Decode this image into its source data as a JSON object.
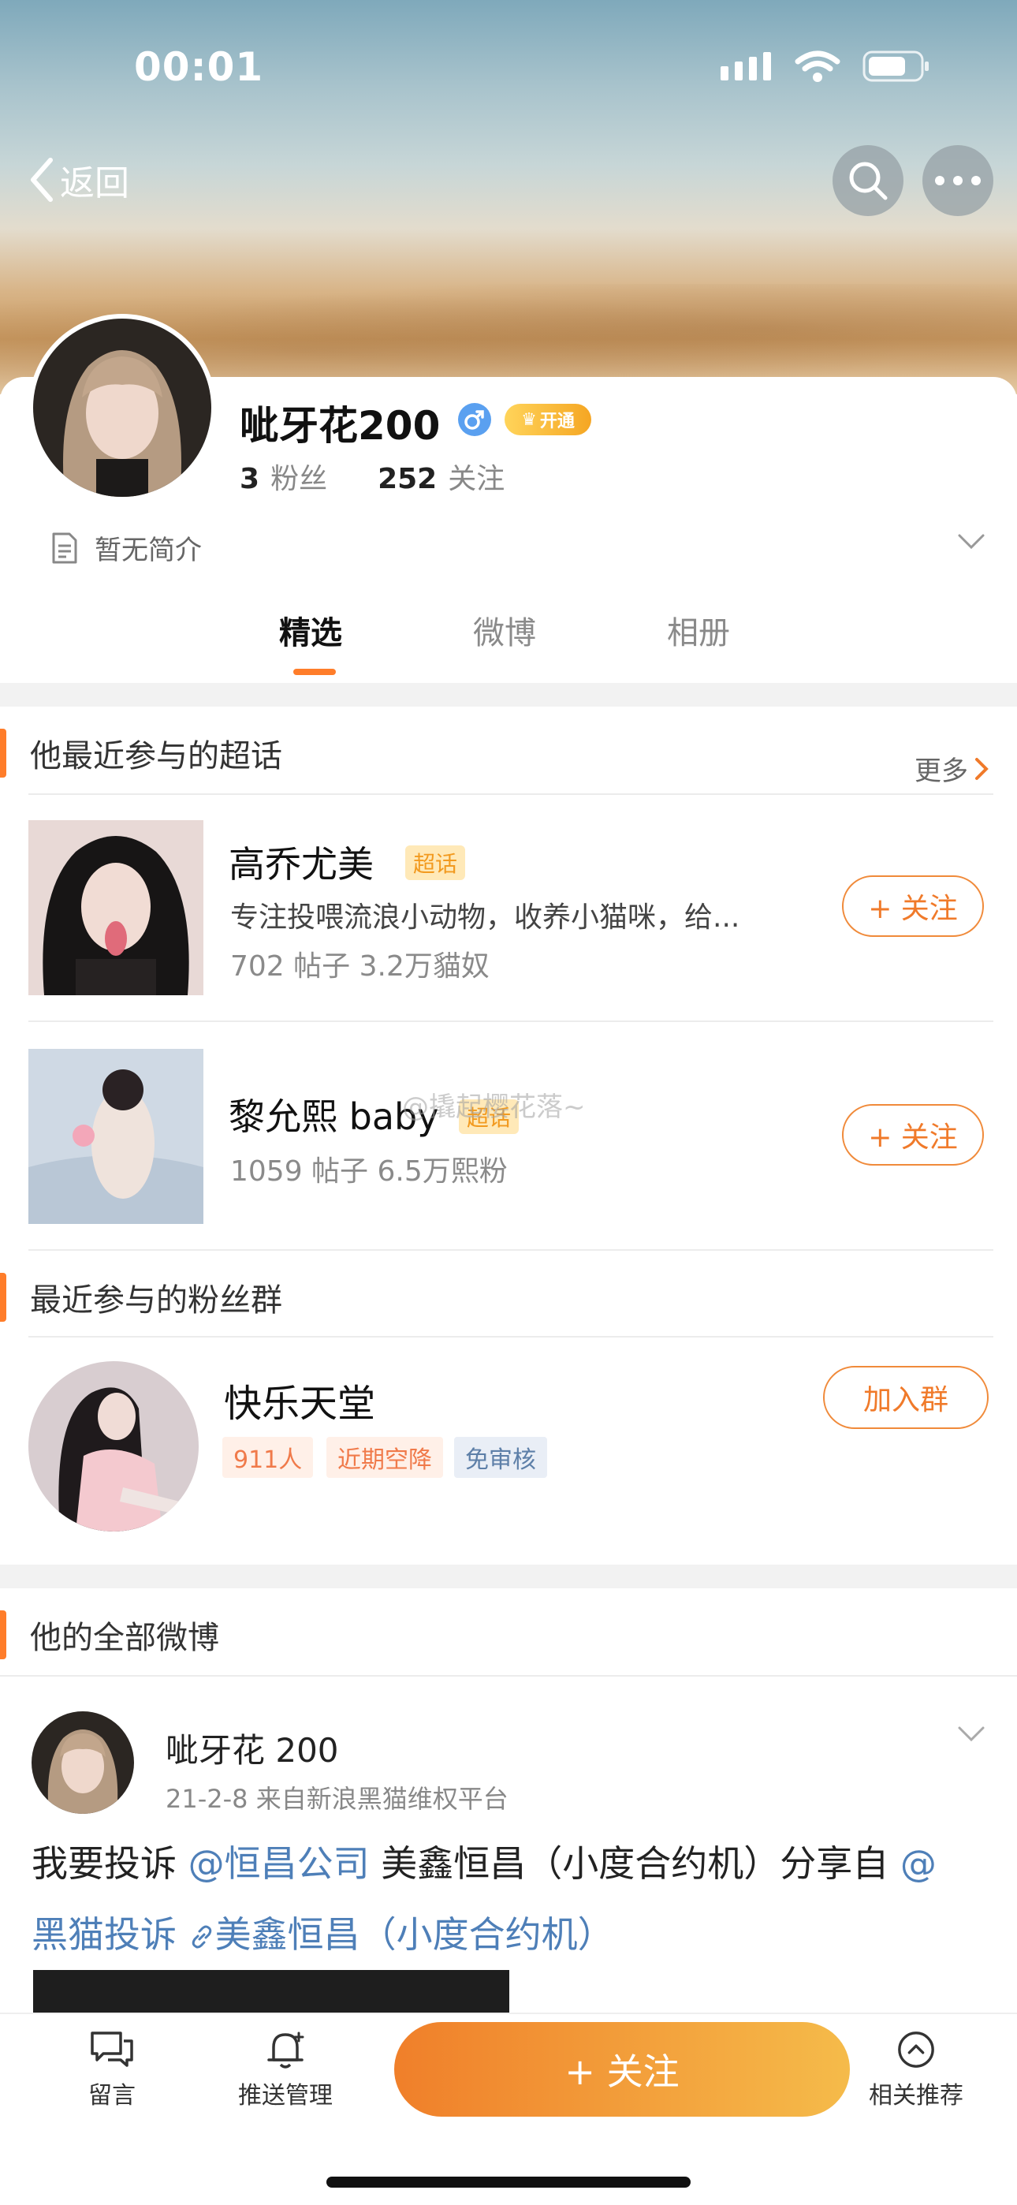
{
  "status_bar": {
    "time": "00:01"
  },
  "header": {
    "back_label": "返回"
  },
  "profile": {
    "username": "呲牙花200",
    "vip_label": "开通",
    "fans_count": "3",
    "fans_label": "粉丝",
    "following_count": "252",
    "following_label": "关注",
    "bio": "暂无简介"
  },
  "tabs": [
    {
      "label": "精选",
      "active": true
    },
    {
      "label": "微博",
      "active": false
    },
    {
      "label": "相册",
      "active": false
    }
  ],
  "supertopics": {
    "title": "他最近参与的超话",
    "more_label": "更多",
    "items": [
      {
        "name": "高乔尤美",
        "tag": "超话",
        "description": "专注投喂流浪小动物，收养小猫咪，给...",
        "stats": "702 帖子 3.2万貓奴",
        "follow_label": "+ 关注"
      },
      {
        "name": "黎允熙 baby",
        "tag": "超话",
        "stats": "1059 帖子 6.5万熙粉",
        "follow_label": "+ 关注"
      }
    ],
    "watermark": "@撬起樱花落~"
  },
  "fan_groups": {
    "title": "最近参与的粉丝群",
    "group_name": "快乐天堂",
    "chips": [
      "911人",
      "近期空降",
      "免审核"
    ],
    "join_label": "加入群"
  },
  "posts": {
    "title": "他的全部微博",
    "author": "呲牙花 200",
    "meta": "21-2-8  来自新浪黑猫维权平台",
    "text_1": "我要投诉",
    "mention_1": "@恒昌公司",
    "text_2": " 美鑫恒昌（小度合约机）分享自",
    "mention_2": "@",
    "mention_2b": "黑猫投诉",
    "link_text": "美鑫恒昌（小度合约机）"
  },
  "bottom_bar": {
    "message_label": "留言",
    "push_label": "推送管理",
    "follow_label": "+ 关注",
    "recommend_label": "相关推荐"
  }
}
